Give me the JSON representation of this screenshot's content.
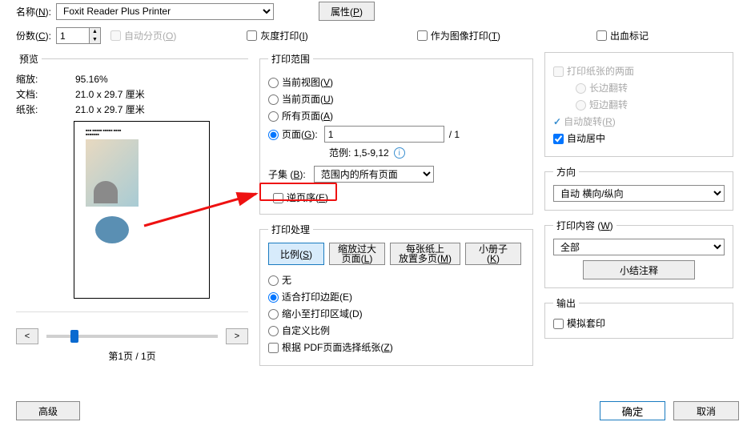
{
  "top": {
    "name_label": "名称(",
    "name_label_u": "N",
    "name_label_end": "):",
    "printer": "Foxit Reader Plus Printer",
    "properties_btn": "属性(",
    "properties_btn_u": "P",
    "properties_btn_end": ")",
    "copies_label": "份数(",
    "copies_label_u": "C",
    "copies_label_end": "):",
    "copies_value": "1",
    "collate_label": "自动分页(",
    "collate_label_u": "O",
    "collate_label_end": ")",
    "grayscale_label": "灰度打印(",
    "grayscale_label_u": "I",
    "grayscale_label_end": ")",
    "asimage_label": "作为图像打印(",
    "asimage_label_u": "T",
    "asimage_label_end": ")",
    "bleed_label": "出血标记"
  },
  "preview": {
    "legend": "预览",
    "zoom_label": "缩放:",
    "zoom_value": "95.16%",
    "doc_label": "文档:",
    "doc_value": "21.0 x 29.7 厘米",
    "paper_label": "纸张:",
    "paper_value": "21.0 x 29.7 厘米",
    "page_status": "第1页 / 1页"
  },
  "range": {
    "legend": "打印范围",
    "current_view": "当前视图(",
    "current_view_u": "V",
    "current_view_end": ")",
    "current_page": "当前页面(",
    "current_page_u": "U",
    "current_page_end": ")",
    "all_pages": "所有页面(",
    "all_pages_u": "A",
    "all_pages_end": ")",
    "pages": "页面(",
    "pages_u": "G",
    "pages_end": ")",
    "page_value": "1",
    "total_pages": "/ 1",
    "example_label": "范例:",
    "example_value": "1,5-9,12",
    "subset_label": "子集 (",
    "subset_label_u": "B",
    "subset_label_end": "):",
    "subset_value": "范围内的所有页面",
    "reverse_label": "逆页序(",
    "reverse_label_u": "E",
    "reverse_label_end": ")"
  },
  "handling": {
    "legend": "打印处理",
    "scale_btn": "比例(",
    "scale_btn_u": "S",
    "scale_btn_end": ")",
    "large_btn_l1": "缩放过大",
    "large_btn_l2": "页面(",
    "large_btn_u": "L",
    "large_btn_end": ")",
    "multi_btn_l1": "每张纸上",
    "multi_btn_l2": "放置多页(",
    "multi_btn_u": "M",
    "multi_btn_end": ")",
    "booklet_btn": "小册子(",
    "booklet_btn_u": "K",
    "booklet_btn_end": ")",
    "none": "无",
    "fit": "适合打印边距(E)",
    "shrink": "缩小至打印区域(D)",
    "custom": "自定义比例",
    "choose_paper": "根据 PDF页面选择纸张(",
    "choose_paper_u": "Z",
    "choose_paper_end": ")"
  },
  "duplex": {
    "both_sides": "打印纸张的两面",
    "long_edge": "长边翻转",
    "short_edge": "短边翻转",
    "auto_rotate": "自动旋转(",
    "auto_rotate_u": "R",
    "auto_rotate_end": ")",
    "auto_center": "自动居中"
  },
  "orient": {
    "legend": "方向",
    "value": "自动 横向/纵向"
  },
  "what": {
    "legend": "打印内容 (",
    "legend_u": "W",
    "legend_end": ")",
    "value": "全部",
    "summarize_btn": "小结注释"
  },
  "output": {
    "legend": "输出",
    "simulate": "模拟套印"
  },
  "buttons": {
    "advanced": "高级",
    "ok": "确定",
    "cancel": "取消"
  }
}
